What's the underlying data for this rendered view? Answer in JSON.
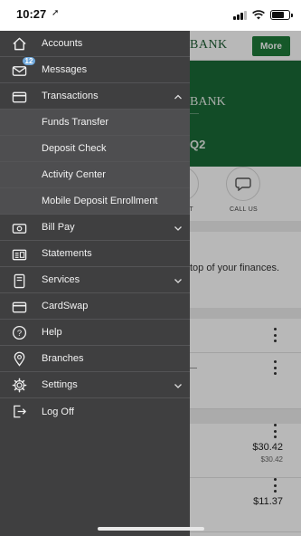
{
  "status_bar": {
    "time": "10:27",
    "location_icon": "location-arrow-icon"
  },
  "background": {
    "bank_name": "BANK",
    "more_label": "More",
    "hero_bank_name": "BANK",
    "hero_bank_sub": "——",
    "hero_q2": "Q2",
    "action_left_label": "UT",
    "action_right_label": "CALL US",
    "message_text": "top of your finances.",
    "amounts": [
      {
        "main": "$30.42",
        "sub": "$30.42"
      },
      {
        "main": "$11.37"
      }
    ]
  },
  "menu": {
    "items": [
      {
        "label": "Accounts",
        "icon": "home-icon"
      },
      {
        "label": "Messages",
        "icon": "envelope-icon",
        "badge": "12"
      },
      {
        "label": "Transactions",
        "icon": "card-icon",
        "expanded": true
      },
      {
        "label": "Funds Transfer",
        "sub": true
      },
      {
        "label": "Deposit Check",
        "sub": true
      },
      {
        "label": "Activity Center",
        "sub": true
      },
      {
        "label": "Mobile Deposit Enrollment",
        "sub": true
      },
      {
        "label": "Bill Pay",
        "icon": "bill-icon",
        "expandable": true
      },
      {
        "label": "Statements",
        "icon": "statement-icon"
      },
      {
        "label": "Services",
        "icon": "services-icon",
        "expandable": true
      },
      {
        "label": "CardSwap",
        "icon": "card-icon"
      },
      {
        "label": "Help",
        "icon": "help-icon"
      },
      {
        "label": "Branches",
        "icon": "location-pin-icon"
      },
      {
        "label": "Settings",
        "icon": "gear-icon",
        "expandable": true
      },
      {
        "label": "Log Off",
        "icon": "logout-icon"
      }
    ]
  },
  "colors": {
    "drawer_bg": "#3f3f40",
    "sub_bg": "#4e4e50",
    "brand_green": "#1e7a3a",
    "hero_green": "#1a6a36",
    "badge": "#6fa8dc"
  }
}
